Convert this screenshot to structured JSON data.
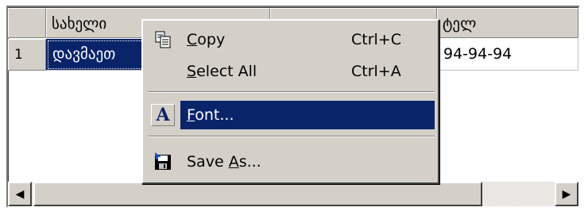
{
  "grid": {
    "headers": [
      "სახელი",
      "",
      "ტელ"
    ],
    "rows": [
      {
        "num": "1",
        "cells": [
          "დავმაეთ",
          "",
          "94-94-94"
        ]
      }
    ]
  },
  "context_menu": {
    "items": [
      {
        "pre": "",
        "key": "C",
        "post": "opy",
        "shortcut": "Ctrl+C",
        "icon": "copy-icon"
      },
      {
        "pre": "",
        "key": "S",
        "post": "elect All",
        "shortcut": "Ctrl+A",
        "icon": ""
      },
      {
        "pre": "",
        "key": "F",
        "post": "ont...",
        "shortcut": "",
        "icon": "font-icon",
        "icon_glyph": "A"
      },
      {
        "pre": "Save ",
        "key": "A",
        "post": "s...",
        "shortcut": "",
        "icon": "save-icon"
      }
    ],
    "highlight_color": "#0a246a"
  },
  "scrollbar": {
    "left_arrow": "◀",
    "right_arrow": "▶"
  }
}
